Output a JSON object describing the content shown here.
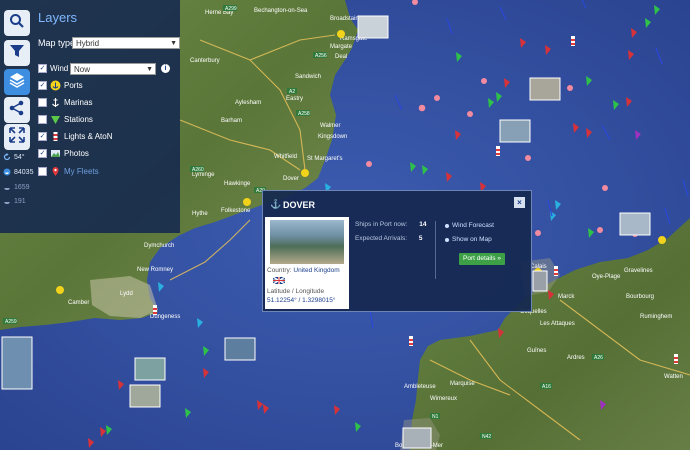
{
  "map": {
    "colors": {
      "sea": "#3452a0",
      "land": "#5f7a3c",
      "panel": "#142850",
      "accent": "#3d8de0"
    },
    "place_labels": [
      "Herne Bay",
      "Margate",
      "Broadstairs",
      "Bechangton-on-Sea",
      "Ramsgate",
      "Canterbury",
      "Sandwich",
      "Aylesham",
      "Eastry",
      "Barham",
      "Walmer",
      "Kingsdown",
      "Whitfield",
      "St Margaret's",
      "Lyminge",
      "Hawkinge",
      "Folkestone",
      "Hythe",
      "Dymchurch",
      "New Romney",
      "Lydd",
      "Camber",
      "Dungeness",
      "Deal",
      "Dover",
      "Calais",
      "Gravelines",
      "Marck",
      "Oye-Plage",
      "Bourbourg",
      "Coquelles",
      "Les Attaques",
      "Guînes",
      "Ardres",
      "Ambleteuse",
      "Marquise",
      "Wimereux",
      "Boulogne-sur-Mer",
      "Ruminghem",
      "Watten"
    ],
    "road_labels": [
      "A299",
      "A256",
      "A258",
      "A20",
      "A2",
      "A260",
      "A259",
      "A16",
      "A26",
      "N42",
      "N1"
    ]
  },
  "tools": {
    "icons": [
      "search-icon",
      "filter-icon",
      "layers-icon",
      "share-icon",
      "fullscreen-icon"
    ],
    "stats": {
      "temperature": "54°",
      "ships": "84035",
      "count_a": "1659",
      "count_b": "191"
    }
  },
  "layers_panel": {
    "title": "Layers",
    "map_type_label": "Map type",
    "map_type_value": "Hybrid",
    "wind_label": "Wind",
    "wind_value": "Now",
    "items": [
      {
        "label": "Ports",
        "checked": true
      },
      {
        "label": "Marinas",
        "checked": false
      },
      {
        "label": "Stations",
        "checked": false
      },
      {
        "label": "Lights & AtoN",
        "checked": true
      },
      {
        "label": "Photos",
        "checked": true
      },
      {
        "label": "My Fleets",
        "checked": false
      }
    ]
  },
  "popup": {
    "title": "DOVER",
    "country_label": "Country:",
    "country_value": "United Kingdom",
    "latlon_label": "Latitude / Longitude",
    "latlon_value": "51.12254° / 1.3298015°",
    "ships_in_port_label": "Ships in Port now:",
    "ships_in_port_value": "14",
    "expected_arrivals_label": "Expected Arrivals:",
    "expected_arrivals_value": "5",
    "wind_forecast_link": "Wind Forecast",
    "show_on_map_link": "Show on Map",
    "port_details_button": "Port details »",
    "close": "×"
  }
}
